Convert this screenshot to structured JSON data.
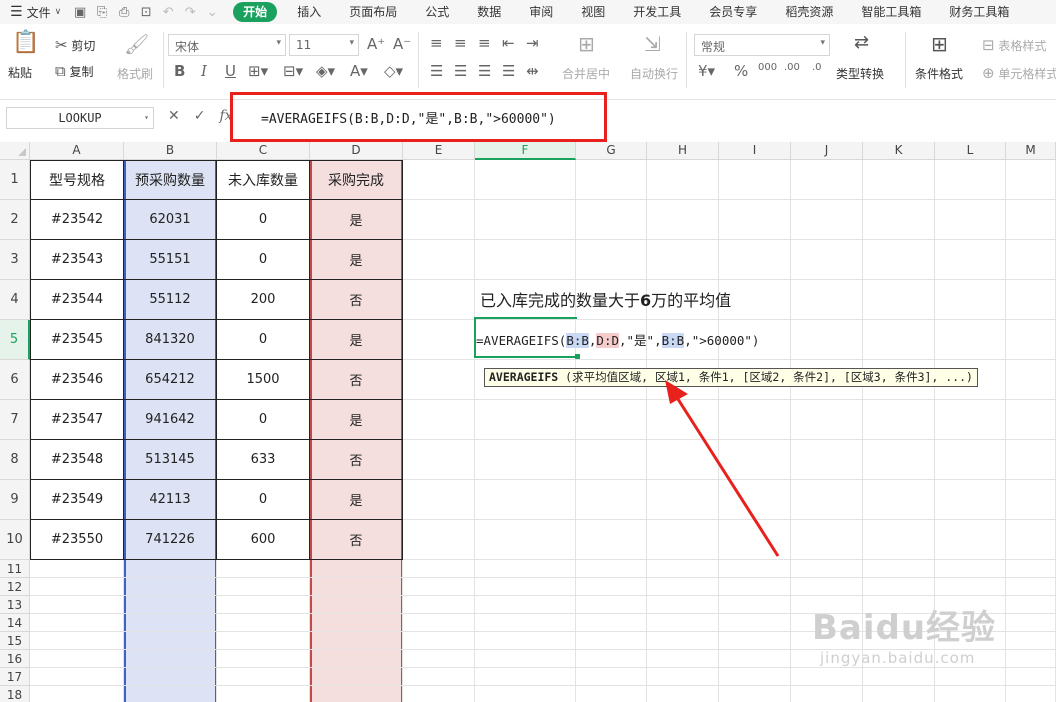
{
  "menubar": {
    "file_label": "文件",
    "tabs": [
      "开始",
      "插入",
      "页面布局",
      "公式",
      "数据",
      "审阅",
      "视图",
      "开发工具",
      "会员专享",
      "稻壳资源",
      "智能工具箱",
      "财务工具箱"
    ],
    "active_tab": "开始"
  },
  "ribbon": {
    "paste": "粘贴",
    "cut": "剪切",
    "copy": "复制",
    "format_painter": "格式刷",
    "font_name": "宋体",
    "font_size": "11",
    "merge_center": "合并居中",
    "wrap_text": "自动换行",
    "number_format": "常规",
    "type_convert": "类型转换",
    "conditional_format": "条件格式",
    "table_style": "表格样式",
    "cell_style": "单元格样式"
  },
  "formula_bar": {
    "name_box": "LOOKUP",
    "fx_label": "fx",
    "formula": "=AVERAGEIFS(B:B,D:D,\"是\",B:B,\">60000\")"
  },
  "columns": [
    "A",
    "B",
    "C",
    "D",
    "E",
    "F",
    "G",
    "H",
    "I",
    "J",
    "K",
    "L",
    "M"
  ],
  "selected_column": "F",
  "rows": [
    "1",
    "2",
    "3",
    "4",
    "5",
    "6",
    "7",
    "8",
    "9",
    "10",
    "11",
    "12",
    "13",
    "14",
    "15",
    "16",
    "17",
    "18"
  ],
  "selected_row": "5",
  "table": {
    "headers": [
      "型号规格",
      "预采购数量",
      "未入库数量",
      "采购完成"
    ],
    "rows": [
      [
        "#23542",
        "62031",
        "0",
        "是"
      ],
      [
        "#23543",
        "55151",
        "0",
        "是"
      ],
      [
        "#23544",
        "55112",
        "200",
        "否"
      ],
      [
        "#23545",
        "841320",
        "0",
        "是"
      ],
      [
        "#23546",
        "654212",
        "1500",
        "否"
      ],
      [
        "#23547",
        "941642",
        "0",
        "是"
      ],
      [
        "#23548",
        "513145",
        "633",
        "否"
      ],
      [
        "#23549",
        "42113",
        "0",
        "是"
      ],
      [
        "#23550",
        "741226",
        "600",
        "否"
      ]
    ]
  },
  "note": {
    "text_before": "已入库完成的数量大于",
    "number": "6",
    "text_after": "万的平均值"
  },
  "editor": {
    "fn": "=AVERAGEIFS(",
    "ref1": "B:B",
    "sep1": ",",
    "ref2": "D:D",
    "crit1": ",\"是\",",
    "ref3": "B:B",
    "crit2": ",\">60000\")"
  },
  "tooltip": {
    "fn": "AVERAGEIFS",
    "args": " (求平均值区域, 区域1, 条件1, [区域2, 条件2], [区域3, 条件3], ...)"
  },
  "watermark": {
    "logo": "Baidu经验",
    "url": "jingyan.baidu.com"
  },
  "colors": {
    "accent": "#1aa15e",
    "annotation_red": "#e8211d",
    "col_b_fill": "#dde3f4",
    "col_d_fill": "#f5dede"
  }
}
